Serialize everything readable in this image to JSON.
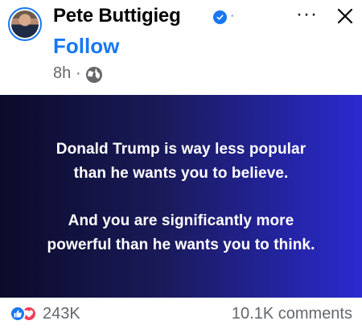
{
  "author": {
    "name": "Pete Buttigieg",
    "verified_separator": "·",
    "follow_label": "Follow"
  },
  "meta": {
    "time": "8h",
    "separator": "·",
    "audience_icon": "globe-icon"
  },
  "actions": {
    "more_label": "···",
    "close_icon": "close-icon"
  },
  "post": {
    "paragraph1_line1": "Donald Trump is way less popular",
    "paragraph1_line2": "than he wants you to believe.",
    "paragraph2_line1": "And you are significantly more",
    "paragraph2_line2": "powerful than he wants you to think.",
    "background_gradient": [
      "#0b0b2a",
      "#1a1a5a",
      "#2a2ad0"
    ]
  },
  "engagement": {
    "reaction_count": "243K",
    "comments": "10.1K comments"
  },
  "colors": {
    "brand": "#1877f2",
    "secondary_text": "#65676b",
    "love": "#f33e58"
  }
}
